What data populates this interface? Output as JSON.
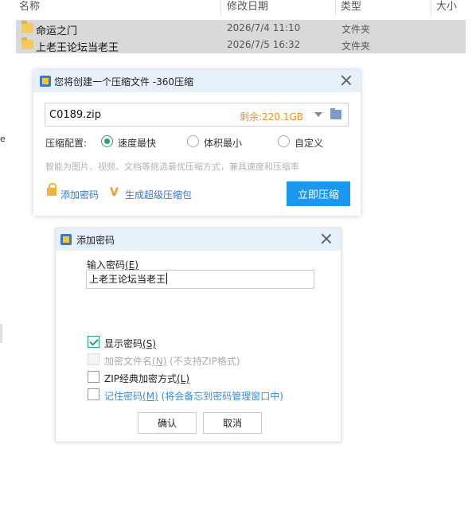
{
  "explorer": {
    "columns": {
      "name": "名称",
      "date": "修改日期",
      "type": "类型",
      "size": "大小"
    },
    "rows": [
      {
        "name": "命运之门",
        "date": "2026/7/4 11:10",
        "type": "文件夹"
      },
      {
        "name": "上老王论坛当老王",
        "date": "2026/7/5 16:32",
        "type": "文件夹"
      }
    ],
    "left_fragment": "e"
  },
  "compress_dialog": {
    "title": "您将创建一个压缩文件 -360压缩",
    "archive_name": "C0189.zip",
    "space_remaining": "剩余:220.1GB",
    "config_label": "压缩配置:",
    "options": [
      {
        "label": "速度最快",
        "selected": true
      },
      {
        "label": "体积最小",
        "selected": false
      },
      {
        "label": "自定义",
        "selected": false
      }
    ],
    "hint": "智能为图片、视频、文档等挑选最优压缩方式，兼具速度和压缩率",
    "add_password_link": "添加密码",
    "super_archive_link": "生成超级压缩包",
    "compress_button": "立即压缩",
    "colors": {
      "accent": "#1a98f0",
      "space": "#e69320",
      "link": "#3c78c2",
      "radio": "#27a36a"
    }
  },
  "password_dialog": {
    "title": "添加密码",
    "input_label": "输入密码",
    "input_label_key": "(E)",
    "password_value": "上老王论坛当老王",
    "checkboxes": {
      "show_password": {
        "label": "显示密码",
        "key": "(S)",
        "checked": true,
        "enabled": true
      },
      "encrypt_names": {
        "label": "加密文件名",
        "key": "(N)",
        "note": " (不支持ZIP格式)",
        "checked": false,
        "enabled": false
      },
      "zip_classic": {
        "label": "ZIP经典加密方式",
        "key": "(L)",
        "checked": false,
        "enabled": true
      },
      "remember": {
        "label": "记住密码",
        "key": "(M)",
        "note": " (将会备忘到密码管理窗口中)",
        "checked": false,
        "enabled": true
      }
    },
    "ok_button": "确认",
    "cancel_button": "取消"
  }
}
